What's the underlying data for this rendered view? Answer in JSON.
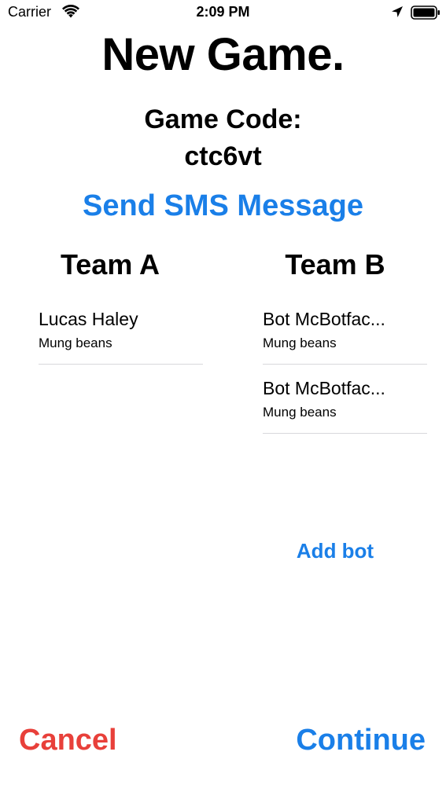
{
  "status_bar": {
    "carrier": "Carrier",
    "time": "2:09 PM",
    "icons": [
      "wifi-icon",
      "location-arrow-icon",
      "battery-icon"
    ]
  },
  "title": "New Game.",
  "game_code": {
    "label": "Game Code:",
    "value": "ctc6vt"
  },
  "send_sms_label": "Send SMS Message",
  "teams": {
    "a": {
      "name": "Team A",
      "players": [
        {
          "name": "Lucas Haley",
          "food": "Mung beans"
        }
      ]
    },
    "b": {
      "name": "Team B",
      "players": [
        {
          "name": "Bot McBotfac...",
          "food": "Mung beans"
        },
        {
          "name": "Bot McBotfac...",
          "food": "Mung beans"
        }
      ],
      "add_bot_label": "Add bot"
    }
  },
  "actions": {
    "cancel_label": "Cancel",
    "continue_label": "Continue"
  },
  "colors": {
    "accent": "#1a7fe8",
    "destructive": "#e8403a",
    "separator": "#d8d8dc"
  }
}
